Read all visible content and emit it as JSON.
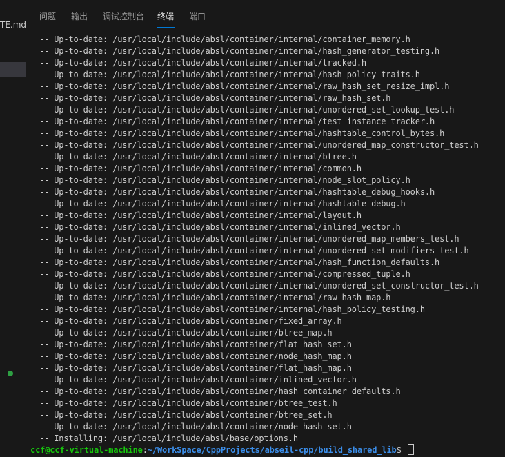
{
  "sidebar": {
    "file_fragment": "TE.md"
  },
  "panel": {
    "tabs": [
      {
        "label": "问题"
      },
      {
        "label": "输出"
      },
      {
        "label": "调试控制台"
      },
      {
        "label": "终端"
      },
      {
        "label": "端口"
      }
    ],
    "active_tab": "终端"
  },
  "terminal": {
    "lines": [
      "-- Up-to-date: /usr/local/include/absl/container/internal/container_memory.h",
      "-- Up-to-date: /usr/local/include/absl/container/internal/hash_generator_testing.h",
      "-- Up-to-date: /usr/local/include/absl/container/internal/tracked.h",
      "-- Up-to-date: /usr/local/include/absl/container/internal/hash_policy_traits.h",
      "-- Up-to-date: /usr/local/include/absl/container/internal/raw_hash_set_resize_impl.h",
      "-- Up-to-date: /usr/local/include/absl/container/internal/raw_hash_set.h",
      "-- Up-to-date: /usr/local/include/absl/container/internal/unordered_set_lookup_test.h",
      "-- Up-to-date: /usr/local/include/absl/container/internal/test_instance_tracker.h",
      "-- Up-to-date: /usr/local/include/absl/container/internal/hashtable_control_bytes.h",
      "-- Up-to-date: /usr/local/include/absl/container/internal/unordered_map_constructor_test.h",
      "-- Up-to-date: /usr/local/include/absl/container/internal/btree.h",
      "-- Up-to-date: /usr/local/include/absl/container/internal/common.h",
      "-- Up-to-date: /usr/local/include/absl/container/internal/node_slot_policy.h",
      "-- Up-to-date: /usr/local/include/absl/container/internal/hashtable_debug_hooks.h",
      "-- Up-to-date: /usr/local/include/absl/container/internal/hashtable_debug.h",
      "-- Up-to-date: /usr/local/include/absl/container/internal/layout.h",
      "-- Up-to-date: /usr/local/include/absl/container/internal/inlined_vector.h",
      "-- Up-to-date: /usr/local/include/absl/container/internal/unordered_map_members_test.h",
      "-- Up-to-date: /usr/local/include/absl/container/internal/unordered_set_modifiers_test.h",
      "-- Up-to-date: /usr/local/include/absl/container/internal/hash_function_defaults.h",
      "-- Up-to-date: /usr/local/include/absl/container/internal/compressed_tuple.h",
      "-- Up-to-date: /usr/local/include/absl/container/internal/unordered_set_constructor_test.h",
      "-- Up-to-date: /usr/local/include/absl/container/internal/raw_hash_map.h",
      "-- Up-to-date: /usr/local/include/absl/container/internal/hash_policy_testing.h",
      "-- Up-to-date: /usr/local/include/absl/container/fixed_array.h",
      "-- Up-to-date: /usr/local/include/absl/container/btree_map.h",
      "-- Up-to-date: /usr/local/include/absl/container/flat_hash_set.h",
      "-- Up-to-date: /usr/local/include/absl/container/node_hash_map.h",
      "-- Up-to-date: /usr/local/include/absl/container/flat_hash_map.h",
      "-- Up-to-date: /usr/local/include/absl/container/inlined_vector.h",
      "-- Up-to-date: /usr/local/include/absl/container/hash_container_defaults.h",
      "-- Up-to-date: /usr/local/include/absl/container/btree_test.h",
      "-- Up-to-date: /usr/local/include/absl/container/btree_set.h",
      "-- Up-to-date: /usr/local/include/absl/container/node_hash_set.h",
      "-- Installing: /usr/local/include/absl/base/options.h"
    ],
    "prompt": {
      "user_host": "ccf@ccf-virtual-machine",
      "colon": ":",
      "path": "~/WorkSpace/CppProjects/abseil-cpp/build_shared_lib",
      "dollar": "$ "
    }
  },
  "colors": {
    "panel_bg": "#181818",
    "text": "#cccccc",
    "prompt_user": "#16c60c",
    "prompt_path": "#3b8eea",
    "accent": "#0078d4"
  }
}
